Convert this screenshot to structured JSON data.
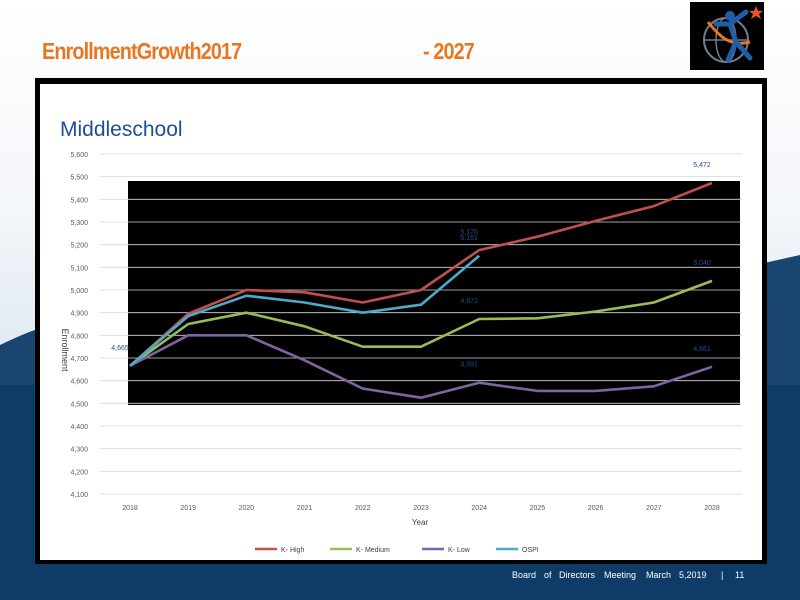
{
  "slide": {
    "title_left": "EnrollmentGrowth2017",
    "title_right": "- 2027",
    "footer": {
      "org": "Board",
      "of": "of",
      "directors": "Directors",
      "meeting": "Meeting",
      "month": "March",
      "date": "5,2019",
      "separator": "|",
      "page": "11"
    }
  },
  "colors": {
    "title_orange": "#e87722",
    "navy": "#0e3c67",
    "high": "#c0504d",
    "medium": "#9bbb59",
    "low": "#8064a2",
    "ospi": "#4bacc6"
  },
  "chart_data": {
    "type": "line",
    "title": "Middleschool",
    "xlabel": "Year",
    "ylabel": "Enrollment",
    "x": [
      "2018",
      "2019",
      "2020",
      "2021",
      "2022",
      "2023",
      "2024",
      "2025",
      "2026",
      "2027",
      "2028"
    ],
    "ylim": [
      4100,
      5600
    ],
    "ytick_labels": [
      "4,100",
      "4,200",
      "4,300",
      "4,400",
      "4,500",
      "4,600",
      "4,700",
      "4,800",
      "4,900",
      "5,000",
      "5,100",
      "5,200",
      "5,300",
      "5,400",
      "5,500",
      "5,600"
    ],
    "grid": true,
    "legend_position": "bottom",
    "series": [
      {
        "name": "K- High",
        "color": "#c0504d",
        "values": [
          4665,
          4895,
          5000,
          4990,
          4945,
          5000,
          5176,
          5235,
          5305,
          5370,
          5472
        ]
      },
      {
        "name": "K- Medium",
        "color": "#9bbb59",
        "values": [
          4665,
          4850,
          4900,
          4840,
          4750,
          4750,
          4872,
          4875,
          4905,
          4945,
          5040
        ]
      },
      {
        "name": "K- Low",
        "color": "#8064a2",
        "values": [
          4665,
          4800,
          4800,
          4690,
          4565,
          4525,
          4591,
          4555,
          4555,
          4575,
          4661
        ]
      },
      {
        "name": "OSPI",
        "color": "#4bacc6",
        "values": [
          4665,
          4885,
          4975,
          4945,
          4900,
          4935,
          5151,
          null,
          null,
          null,
          null
        ]
      }
    ],
    "data_labels": [
      {
        "text": "4,665",
        "series": 3,
        "index": 0
      },
      {
        "text": "5,176",
        "series": 0,
        "index": 6
      },
      {
        "text": "5,151",
        "series": 3,
        "index": 6
      },
      {
        "text": "4,872",
        "series": 1,
        "index": 6
      },
      {
        "text": "4,591",
        "series": 2,
        "index": 6
      },
      {
        "text": "5,472",
        "series": 0,
        "index": 10
      },
      {
        "text": "5,040",
        "series": 1,
        "index": 10
      },
      {
        "text": "4,661",
        "series": 2,
        "index": 10
      }
    ]
  }
}
